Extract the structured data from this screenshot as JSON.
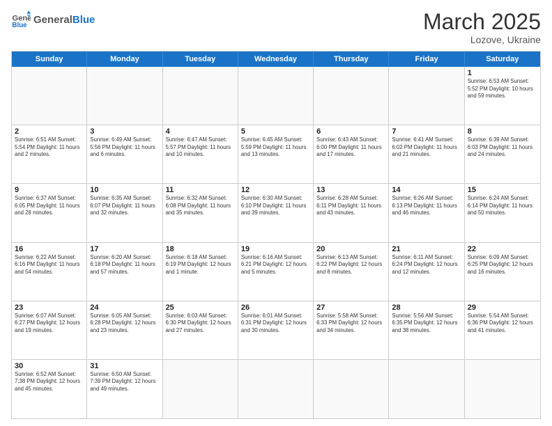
{
  "header": {
    "logo_general": "General",
    "logo_blue": "Blue",
    "title": "March 2025",
    "location": "Lozove, Ukraine"
  },
  "days_of_week": [
    "Sunday",
    "Monday",
    "Tuesday",
    "Wednesday",
    "Thursday",
    "Friday",
    "Saturday"
  ],
  "weeks": [
    [
      {
        "day": "",
        "info": ""
      },
      {
        "day": "",
        "info": ""
      },
      {
        "day": "",
        "info": ""
      },
      {
        "day": "",
        "info": ""
      },
      {
        "day": "",
        "info": ""
      },
      {
        "day": "",
        "info": ""
      },
      {
        "day": "1",
        "info": "Sunrise: 6:53 AM\nSunset: 5:52 PM\nDaylight: 10 hours\nand 59 minutes."
      }
    ],
    [
      {
        "day": "2",
        "info": "Sunrise: 6:51 AM\nSunset: 5:54 PM\nDaylight: 11 hours\nand 2 minutes."
      },
      {
        "day": "3",
        "info": "Sunrise: 6:49 AM\nSunset: 5:56 PM\nDaylight: 11 hours\nand 6 minutes."
      },
      {
        "day": "4",
        "info": "Sunrise: 6:47 AM\nSunset: 5:57 PM\nDaylight: 11 hours\nand 10 minutes."
      },
      {
        "day": "5",
        "info": "Sunrise: 6:45 AM\nSunset: 5:59 PM\nDaylight: 11 hours\nand 13 minutes."
      },
      {
        "day": "6",
        "info": "Sunrise: 6:43 AM\nSunset: 6:00 PM\nDaylight: 11 hours\nand 17 minutes."
      },
      {
        "day": "7",
        "info": "Sunrise: 6:41 AM\nSunset: 6:02 PM\nDaylight: 11 hours\nand 21 minutes."
      },
      {
        "day": "8",
        "info": "Sunrise: 6:39 AM\nSunset: 6:03 PM\nDaylight: 11 hours\nand 24 minutes."
      }
    ],
    [
      {
        "day": "9",
        "info": "Sunrise: 6:37 AM\nSunset: 6:05 PM\nDaylight: 11 hours\nand 28 minutes."
      },
      {
        "day": "10",
        "info": "Sunrise: 6:35 AM\nSunset: 6:07 PM\nDaylight: 11 hours\nand 32 minutes."
      },
      {
        "day": "11",
        "info": "Sunrise: 6:32 AM\nSunset: 6:08 PM\nDaylight: 11 hours\nand 35 minutes."
      },
      {
        "day": "12",
        "info": "Sunrise: 6:30 AM\nSunset: 6:10 PM\nDaylight: 11 hours\nand 39 minutes."
      },
      {
        "day": "13",
        "info": "Sunrise: 6:28 AM\nSunset: 6:11 PM\nDaylight: 11 hours\nand 43 minutes."
      },
      {
        "day": "14",
        "info": "Sunrise: 6:26 AM\nSunset: 6:13 PM\nDaylight: 11 hours\nand 46 minutes."
      },
      {
        "day": "15",
        "info": "Sunrise: 6:24 AM\nSunset: 6:14 PM\nDaylight: 11 hours\nand 50 minutes."
      }
    ],
    [
      {
        "day": "16",
        "info": "Sunrise: 6:22 AM\nSunset: 6:16 PM\nDaylight: 11 hours\nand 54 minutes."
      },
      {
        "day": "17",
        "info": "Sunrise: 6:20 AM\nSunset: 6:18 PM\nDaylight: 11 hours\nand 57 minutes."
      },
      {
        "day": "18",
        "info": "Sunrise: 6:18 AM\nSunset: 6:19 PM\nDaylight: 12 hours\nand 1 minute."
      },
      {
        "day": "19",
        "info": "Sunrise: 6:16 AM\nSunset: 6:21 PM\nDaylight: 12 hours\nand 5 minutes."
      },
      {
        "day": "20",
        "info": "Sunrise: 6:13 AM\nSunset: 6:22 PM\nDaylight: 12 hours\nand 8 minutes."
      },
      {
        "day": "21",
        "info": "Sunrise: 6:11 AM\nSunset: 6:24 PM\nDaylight: 12 hours\nand 12 minutes."
      },
      {
        "day": "22",
        "info": "Sunrise: 6:09 AM\nSunset: 6:25 PM\nDaylight: 12 hours\nand 16 minutes."
      }
    ],
    [
      {
        "day": "23",
        "info": "Sunrise: 6:07 AM\nSunset: 6:27 PM\nDaylight: 12 hours\nand 19 minutes."
      },
      {
        "day": "24",
        "info": "Sunrise: 6:05 AM\nSunset: 6:28 PM\nDaylight: 12 hours\nand 23 minutes."
      },
      {
        "day": "25",
        "info": "Sunrise: 6:03 AM\nSunset: 6:30 PM\nDaylight: 12 hours\nand 27 minutes."
      },
      {
        "day": "26",
        "info": "Sunrise: 6:01 AM\nSunset: 6:31 PM\nDaylight: 12 hours\nand 30 minutes."
      },
      {
        "day": "27",
        "info": "Sunrise: 5:58 AM\nSunset: 6:33 PM\nDaylight: 12 hours\nand 34 minutes."
      },
      {
        "day": "28",
        "info": "Sunrise: 5:56 AM\nSunset: 6:35 PM\nDaylight: 12 hours\nand 38 minutes."
      },
      {
        "day": "29",
        "info": "Sunrise: 5:54 AM\nSunset: 6:36 PM\nDaylight: 12 hours\nand 41 minutes."
      }
    ],
    [
      {
        "day": "30",
        "info": "Sunrise: 6:52 AM\nSunset: 7:38 PM\nDaylight: 12 hours\nand 45 minutes."
      },
      {
        "day": "31",
        "info": "Sunrise: 6:50 AM\nSunset: 7:39 PM\nDaylight: 12 hours\nand 49 minutes."
      },
      {
        "day": "",
        "info": ""
      },
      {
        "day": "",
        "info": ""
      },
      {
        "day": "",
        "info": ""
      },
      {
        "day": "",
        "info": ""
      },
      {
        "day": "",
        "info": ""
      }
    ]
  ]
}
